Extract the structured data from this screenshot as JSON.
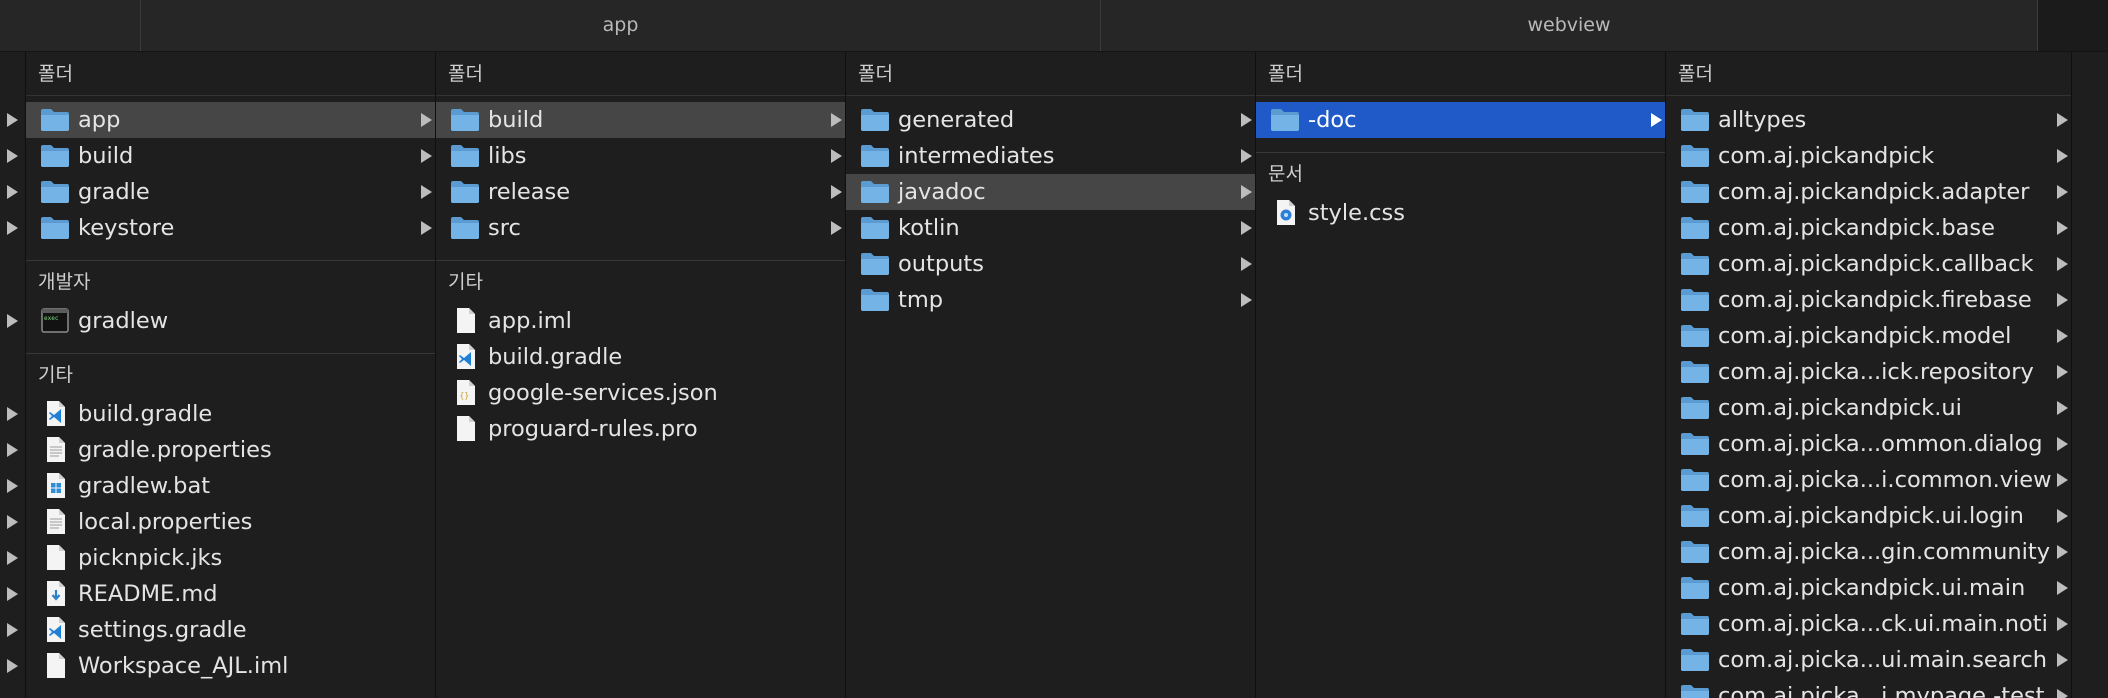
{
  "tabs": [
    "",
    "app",
    "webview",
    ""
  ],
  "columns": [
    {
      "sections": [
        {
          "header": "폴더",
          "items": [
            {
              "label": "app",
              "icon": "folder-icon",
              "arrow": true,
              "state": "selected"
            },
            {
              "label": "build",
              "icon": "folder-icon",
              "arrow": true
            },
            {
              "label": "gradle",
              "icon": "folder-icon",
              "arrow": true
            },
            {
              "label": "keystore",
              "icon": "folder-icon",
              "arrow": true
            }
          ]
        },
        {
          "header": "개발자",
          "items": [
            {
              "label": "gradlew",
              "icon": "terminal-icon"
            }
          ]
        },
        {
          "header": "기타",
          "items": [
            {
              "label": "build.gradle",
              "icon": "vscode-file-icon"
            },
            {
              "label": "gradle.properties",
              "icon": "text-file-icon"
            },
            {
              "label": "gradlew.bat",
              "icon": "windows-file-icon"
            },
            {
              "label": "local.properties",
              "icon": "text-file-icon"
            },
            {
              "label": "picknpick.jks",
              "icon": "blank-file-icon"
            },
            {
              "label": "README.md",
              "icon": "markdown-file-icon"
            },
            {
              "label": "settings.gradle",
              "icon": "vscode-file-icon"
            },
            {
              "label": "Workspace_AJL.iml",
              "icon": "blank-file-icon"
            }
          ]
        }
      ]
    },
    {
      "sections": [
        {
          "header": "폴더",
          "items": [
            {
              "label": "build",
              "icon": "folder-icon",
              "arrow": true,
              "state": "selected"
            },
            {
              "label": "libs",
              "icon": "folder-icon",
              "arrow": true
            },
            {
              "label": "release",
              "icon": "folder-icon",
              "arrow": true
            },
            {
              "label": "src",
              "icon": "folder-icon",
              "arrow": true
            }
          ]
        },
        {
          "header": "기타",
          "items": [
            {
              "label": "app.iml",
              "icon": "blank-file-icon"
            },
            {
              "label": "build.gradle",
              "icon": "vscode-file-icon"
            },
            {
              "label": "google-services.json",
              "icon": "json-file-icon"
            },
            {
              "label": "proguard-rules.pro",
              "icon": "blank-file-icon"
            }
          ]
        }
      ]
    },
    {
      "sections": [
        {
          "header": "폴더",
          "items": [
            {
              "label": "generated",
              "icon": "folder-icon",
              "arrow": true
            },
            {
              "label": "intermediates",
              "icon": "folder-icon",
              "arrow": true
            },
            {
              "label": "javadoc",
              "icon": "folder-icon",
              "arrow": true,
              "state": "selected"
            },
            {
              "label": "kotlin",
              "icon": "folder-icon",
              "arrow": true
            },
            {
              "label": "outputs",
              "icon": "folder-icon",
              "arrow": true
            },
            {
              "label": "tmp",
              "icon": "folder-icon",
              "arrow": true
            }
          ]
        }
      ]
    },
    {
      "sections": [
        {
          "header": "폴더",
          "items": [
            {
              "label": "-doc",
              "icon": "folder-icon",
              "arrow": true,
              "state": "active"
            }
          ]
        },
        {
          "header": "문서",
          "items": [
            {
              "label": "style.css",
              "icon": "css-file-icon"
            }
          ]
        }
      ]
    },
    {
      "sections": [
        {
          "header": "폴더",
          "items": [
            {
              "label": "alltypes",
              "icon": "folder-icon",
              "arrow": true
            },
            {
              "label": "com.aj.pickandpick",
              "icon": "folder-icon",
              "arrow": true
            },
            {
              "label": "com.aj.pickandpick.adapter",
              "icon": "folder-icon",
              "arrow": true
            },
            {
              "label": "com.aj.pickandpick.base",
              "icon": "folder-icon",
              "arrow": true
            },
            {
              "label": "com.aj.pickandpick.callback",
              "icon": "folder-icon",
              "arrow": true
            },
            {
              "label": "com.aj.pickandpick.firebase",
              "icon": "folder-icon",
              "arrow": true
            },
            {
              "label": "com.aj.pickandpick.model",
              "icon": "folder-icon",
              "arrow": true
            },
            {
              "label": "com.aj.picka...ick.repository",
              "icon": "folder-icon",
              "arrow": true
            },
            {
              "label": "com.aj.pickandpick.ui",
              "icon": "folder-icon",
              "arrow": true
            },
            {
              "label": "com.aj.picka...ommon.dialog",
              "icon": "folder-icon",
              "arrow": true
            },
            {
              "label": "com.aj.picka...i.common.view",
              "icon": "folder-icon",
              "arrow": true
            },
            {
              "label": "com.aj.pickandpick.ui.login",
              "icon": "folder-icon",
              "arrow": true
            },
            {
              "label": "com.aj.picka...gin.community",
              "icon": "folder-icon",
              "arrow": true
            },
            {
              "label": "com.aj.pickandpick.ui.main",
              "icon": "folder-icon",
              "arrow": true
            },
            {
              "label": "com.aj.picka...ck.ui.main.noti",
              "icon": "folder-icon",
              "arrow": true
            },
            {
              "label": "com.aj.picka...ui.main.search",
              "icon": "folder-icon",
              "arrow": true
            },
            {
              "label": "com.aj.picka...i.mypage.-test",
              "icon": "folder-icon",
              "arrow": true
            }
          ]
        }
      ]
    }
  ],
  "colors": {
    "selection_active": "#1f5ac8",
    "selection_inactive": "#464646",
    "folder": "#6aa9dc"
  }
}
